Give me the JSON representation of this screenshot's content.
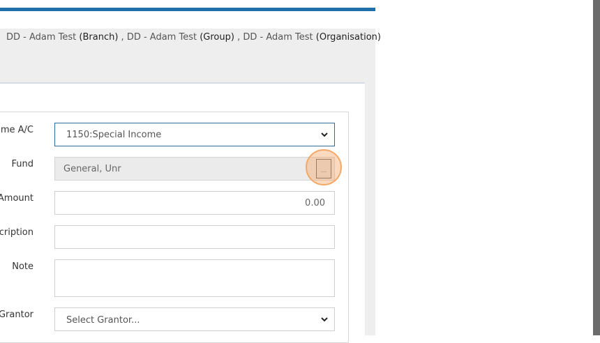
{
  "context": {
    "items": [
      {
        "name": "DD - Adam Test",
        "type": "(Branch)"
      },
      {
        "name": "DD - Adam Test",
        "type": "(Group)"
      },
      {
        "name": "DD - Adam Test",
        "type": "(Organisation)"
      }
    ],
    "separator": " , "
  },
  "form": {
    "income_ac": {
      "label": "Income A/C",
      "value": "1150:Special Income"
    },
    "fund": {
      "label": "Fund",
      "value": "General, Unr",
      "button_label": "..."
    },
    "amount": {
      "label": "Amount",
      "value": "0.00"
    },
    "description": {
      "label": "Description",
      "value": ""
    },
    "note": {
      "label": "Note",
      "value": ""
    },
    "grantor": {
      "label": "Grantor",
      "placeholder": "Select Grantor..."
    }
  },
  "colors": {
    "accent_bar": "#1f6fa8",
    "header_bg": "#efeeef",
    "highlight": "#f3a868",
    "scrollbar": "#6b6b6b"
  }
}
